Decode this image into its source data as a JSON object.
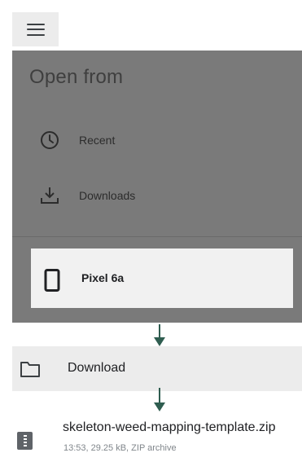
{
  "toolbar": {
    "menu_icon": "hamburger-menu-icon"
  },
  "drawer": {
    "title": "Open from",
    "items": [
      {
        "label": "Recent",
        "icon": "clock-icon"
      },
      {
        "label": "Downloads",
        "icon": "download-icon"
      }
    ],
    "device": {
      "label": "Pixel 6a",
      "icon": "phone-icon"
    }
  },
  "folder": {
    "label": "Download",
    "icon": "folder-icon"
  },
  "file": {
    "name": "skeleton-weed-mapping-template.zip",
    "meta": "13:53, 29.25 kB, ZIP archive",
    "icon": "zip-file-icon"
  },
  "colors": {
    "drawer_bg": "#7a7a7a",
    "arrow": "#2f5d50",
    "highlight_bg": "#f1f1f1",
    "row_bg": "#ececec"
  }
}
